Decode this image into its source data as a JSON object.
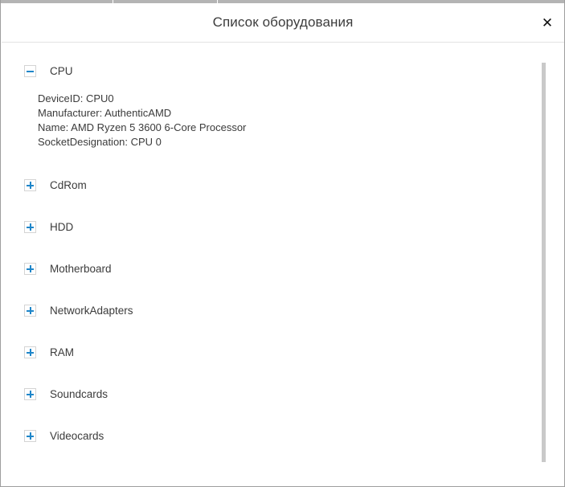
{
  "window": {
    "title": "Список оборудования",
    "close_label": "✕",
    "close_icon": "close-icon"
  },
  "colors": {
    "accent": "#1f86c9",
    "frame_border": "#9e9e9e",
    "header_divider": "#e3e3e3",
    "text": "#3b3b3b",
    "title_text": "#3c3c3c",
    "expander_border": "#d4d4d4",
    "scrollbar_thumb": "#c9c9c9",
    "chrome_strip": "#b4b4b4"
  },
  "tree": {
    "nodes": [
      {
        "label": "CPU",
        "expanded": true,
        "icon": "minus-box-icon",
        "details": [
          "DeviceID: CPU0",
          "Manufacturer: AuthenticAMD",
          "Name: AMD Ryzen 5 3600 6-Core Processor",
          "SocketDesignation: CPU 0"
        ]
      },
      {
        "label": "CdRom",
        "expanded": false,
        "icon": "plus-box-icon",
        "details": []
      },
      {
        "label": "HDD",
        "expanded": false,
        "icon": "plus-box-icon",
        "details": []
      },
      {
        "label": "Motherboard",
        "expanded": false,
        "icon": "plus-box-icon",
        "details": []
      },
      {
        "label": "NetworkAdapters",
        "expanded": false,
        "icon": "plus-box-icon",
        "details": []
      },
      {
        "label": "RAM",
        "expanded": false,
        "icon": "plus-box-icon",
        "details": []
      },
      {
        "label": "Soundcards",
        "expanded": false,
        "icon": "plus-box-icon",
        "details": []
      },
      {
        "label": "Videocards",
        "expanded": false,
        "icon": "plus-box-icon",
        "details": []
      }
    ]
  },
  "scrollbar": {
    "orientation": "vertical",
    "thumb_position_percent": 0
  }
}
